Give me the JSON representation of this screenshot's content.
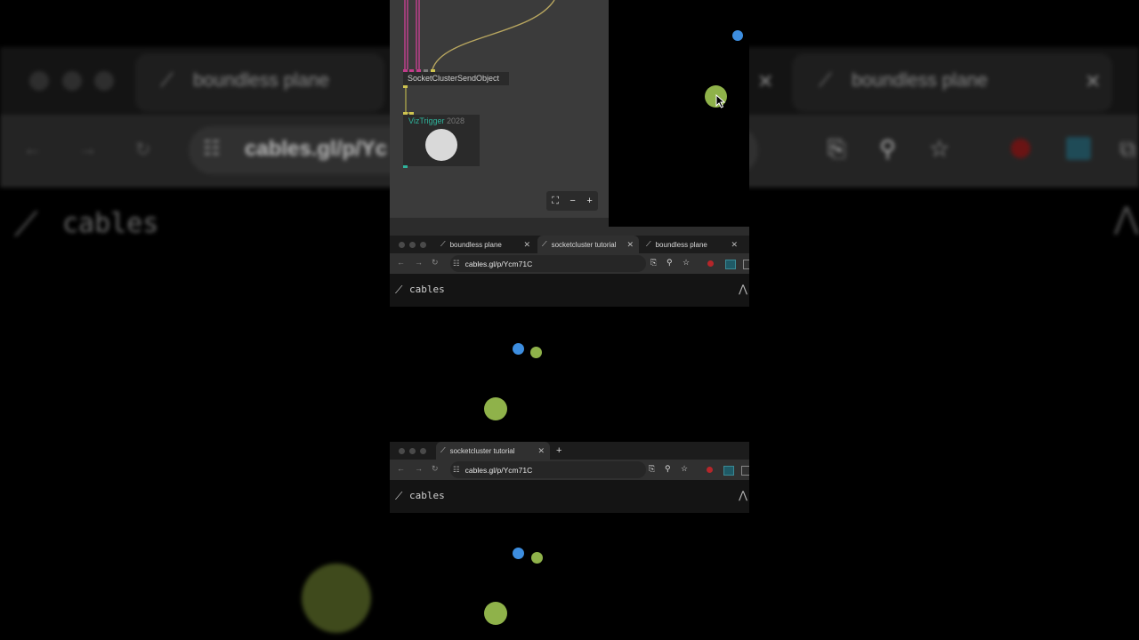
{
  "background": {
    "tab1_title": "boundless plane",
    "tab2_title": "boundless plane",
    "url": "cables.gl/p/Yc",
    "brand": "cables"
  },
  "patch": {
    "node_send": "SocketClusterSendObject",
    "node_viz": "VizTrigger",
    "node_viz_count": "2028",
    "zoom_fit": "⛶",
    "zoom_out": "−",
    "zoom_in": "+"
  },
  "browser1": {
    "tabs": [
      {
        "label": "boundless plane"
      },
      {
        "label": "socketcluster tutorial"
      },
      {
        "label": "boundless plane"
      }
    ],
    "url": "cables.gl/p/Ycm71C",
    "brand": "cables"
  },
  "browser2": {
    "tabs": [
      {
        "label": "socketcluster tutorial"
      }
    ],
    "new_tab": "+",
    "url": "cables.gl/p/Ycm71C",
    "brand": "cables"
  },
  "colors": {
    "blue_ball": "#3d8ee0",
    "green_ball": "#8fb24a",
    "dark_green_ball": "#3f4a1c",
    "accent_teal": "#2fb39b"
  }
}
